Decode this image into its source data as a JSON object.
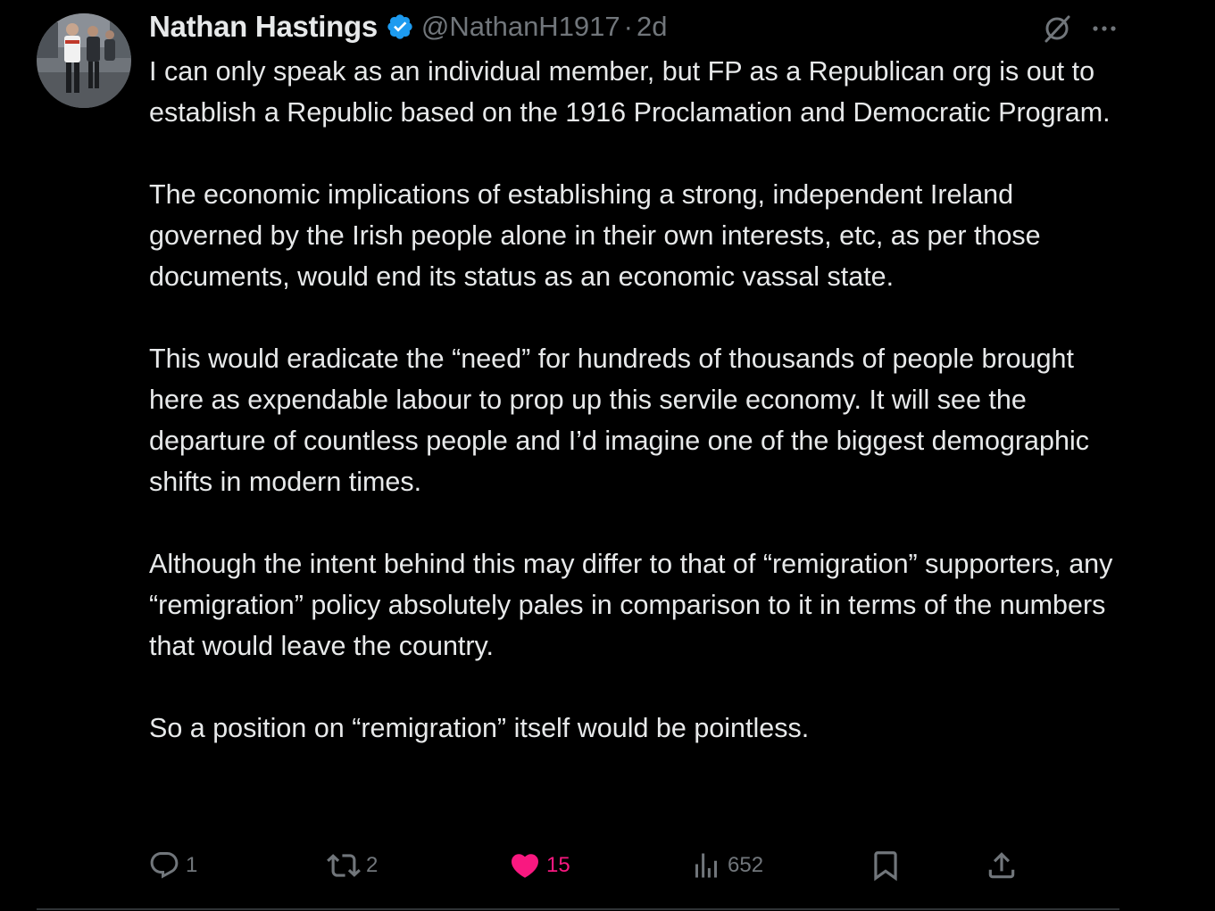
{
  "author": {
    "display_name": "Nathan Hastings",
    "handle": "@NathanH1917",
    "separator": "·",
    "timestamp": "2d",
    "verified": true,
    "verified_color": "#1d9bf0"
  },
  "post": {
    "paragraphs": [
      "I can only speak as an individual member, but FP as a Republican org is out to establish a Republic based on the 1916 Proclamation and Democratic Program.",
      "The economic implications of establishing a strong, independent Ireland governed by the Irish people alone in their own interests, etc, as per those documents, would end its status as an economic vassal state.",
      "This would  eradicate the “need” for hundreds of thousands of people brought here as expendable labour to prop up this servile economy. It will see the departure of countless people and I’d imagine one of the biggest demographic shifts in modern times.",
      "Although the intent behind this may differ to that of “remigration” supporters, any “remigration” policy absolutely pales in comparison to it in terms of the numbers that would leave the country.",
      "So a position on “remigration” itself would be pointless."
    ]
  },
  "actions": {
    "reply": {
      "icon": "reply-icon",
      "count": "1"
    },
    "repost": {
      "icon": "repost-icon",
      "count": "2"
    },
    "like": {
      "icon": "heart-icon",
      "count": "15",
      "active": true,
      "color": "#f91880"
    },
    "views": {
      "icon": "views-icon",
      "count": "652"
    },
    "bookmark": {
      "icon": "bookmark-icon"
    },
    "share": {
      "icon": "share-icon"
    }
  },
  "top_icons": [
    "grok-icon",
    "more-icon"
  ],
  "colors": {
    "background": "#000000",
    "text": "#e7e9ea",
    "secondary": "#71767b",
    "divider": "#2f3336"
  }
}
